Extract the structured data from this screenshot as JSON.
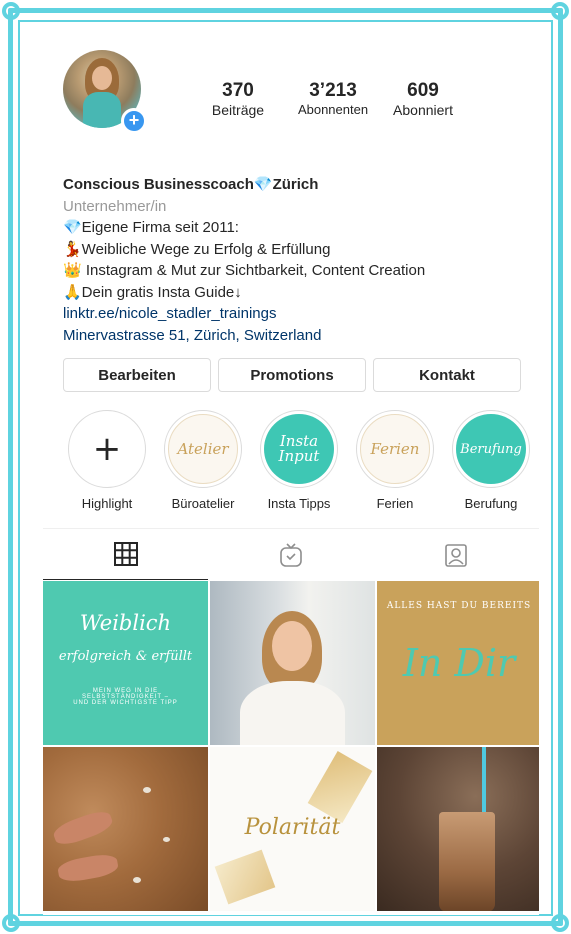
{
  "profile": {
    "stats": [
      {
        "value": "370",
        "label": "Beiträge"
      },
      {
        "value": "3’213",
        "label": "Abonnenten"
      },
      {
        "value": "609",
        "label": "Abonniert"
      }
    ],
    "name": "Conscious Businesscoach💎Zürich",
    "category": "Unternehmer/in",
    "bio_lines": [
      "💎Eigene Firma seit 2011:",
      "💃Weibliche Wege zu Erfolg & Erfüllung",
      "👑 Instagram & Mut zur Sichtbarkeit, Content Creation",
      "🙏Dein gratis Insta Guide↓"
    ],
    "link": "linktr.ee/nicole_stadler_trainings",
    "address": "Minervastrasse 51, Zürich, Switzerland"
  },
  "buttons": {
    "edit": "Bearbeiten",
    "promotions": "Promotions",
    "contact": "Kontakt"
  },
  "highlights": [
    {
      "label": "Highlight",
      "cover": "+"
    },
    {
      "label": "Büroatelier",
      "cover": "Atelier"
    },
    {
      "label": "Insta Tipps",
      "cover": "Insta Input"
    },
    {
      "label": "Ferien",
      "cover": "Ferien"
    },
    {
      "label": "Berufung",
      "cover": "Berufung"
    }
  ],
  "posts": {
    "post1": {
      "title": "Weiblich",
      "subtitle": "erfolgreich & erfüllt",
      "caption": "MEIN WEG IN DIE SELBSTSTÄNDIGKEIT – UND DER WICHTIGSTE TIPP"
    },
    "post3": {
      "top": "ALLES HAST DU BEREITS",
      "script": "In Dir"
    },
    "post5": {
      "script": "Polarität"
    }
  },
  "colors": {
    "accent_blue": "#3897f0",
    "link": "#003569",
    "frame": "#5fd3e0",
    "teal": "#4fc9b0",
    "gold": "#c9a25b"
  }
}
